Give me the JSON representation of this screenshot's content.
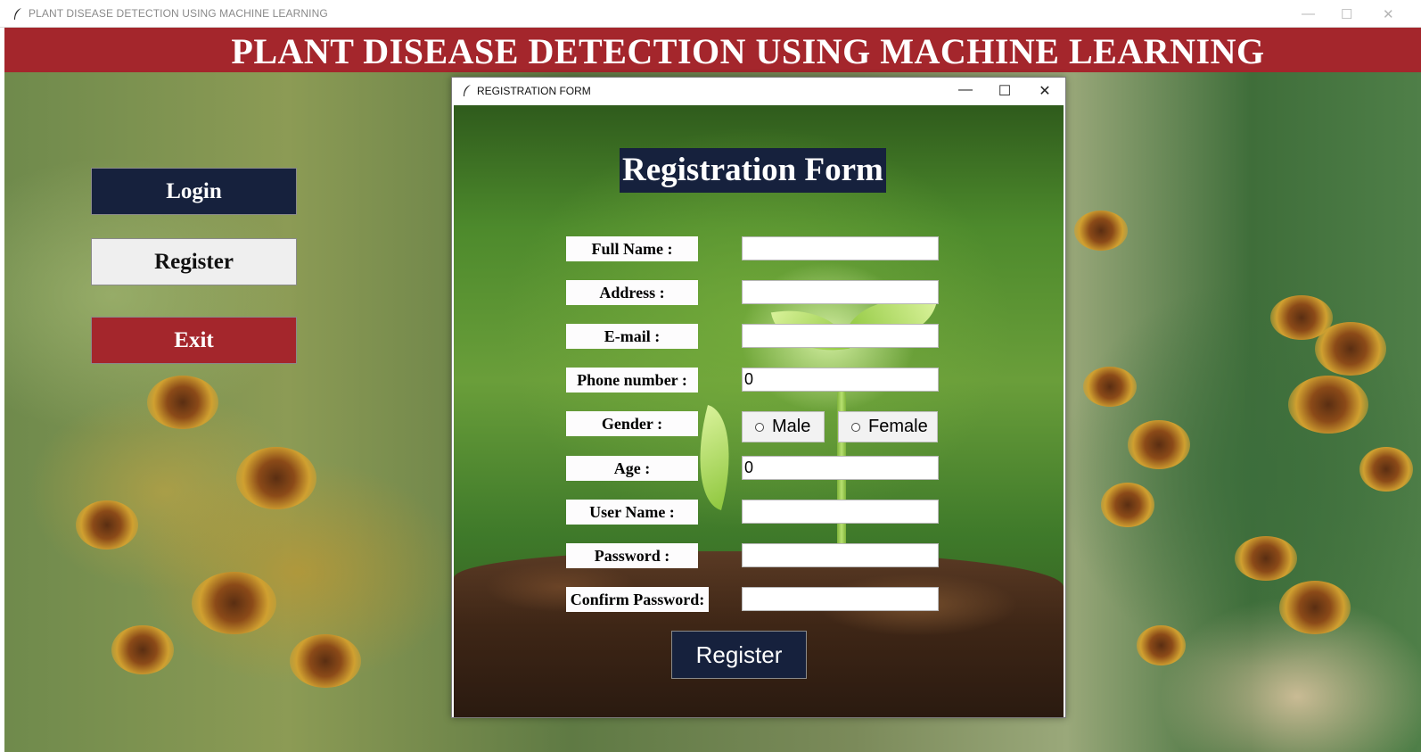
{
  "main_window": {
    "title": "PLANT DISEASE DETECTION USING MACHINE LEARNING",
    "controls": {
      "minimize": "—",
      "maximize": "☐",
      "close": "✕"
    }
  },
  "banner": {
    "heading": "PLANT DISEASE DETECTION USING MACHINE LEARNING",
    "color": "#a4262c"
  },
  "nav": {
    "login_label": "Login",
    "register_label": "Register",
    "exit_label": "Exit",
    "colors": {
      "login": "#16213d",
      "register": "#efefef",
      "exit": "#a4262c"
    }
  },
  "dialog": {
    "title": "REGISTRATION FORM",
    "controls": {
      "minimize": "—",
      "maximize": "☐",
      "close": "✕"
    },
    "heading": "Registration Form",
    "fields": {
      "full_name": {
        "label": "Full Name :",
        "value": ""
      },
      "address": {
        "label": "Address :",
        "value": ""
      },
      "email": {
        "label": "E-mail :",
        "value": ""
      },
      "phone": {
        "label": "Phone number :",
        "value": "0"
      },
      "gender": {
        "label": "Gender :",
        "options": [
          "Male",
          "Female"
        ],
        "selected": ""
      },
      "age": {
        "label": "Age :",
        "value": "0"
      },
      "username": {
        "label": "User Name :",
        "value": ""
      },
      "password": {
        "label": "Password :",
        "value": ""
      },
      "confirm_password": {
        "label": "Confirm Password:",
        "value": ""
      }
    },
    "submit_label": "Register",
    "accent": "#16213d"
  },
  "icons": {
    "app": "feather-icon"
  }
}
